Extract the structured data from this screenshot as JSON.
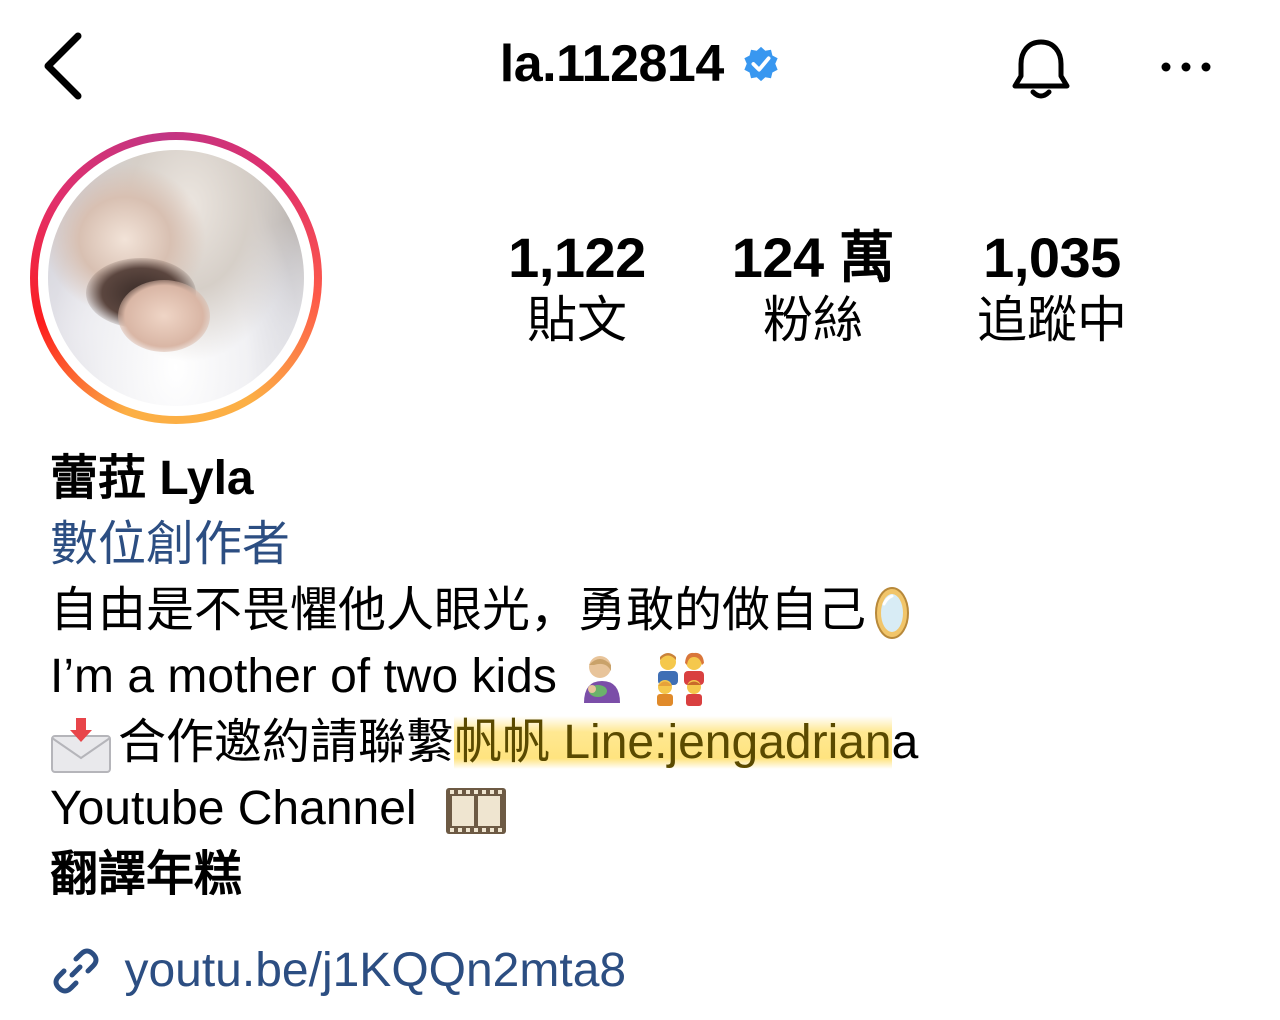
{
  "header": {
    "username": "la.112814",
    "back_icon": "chevron-left-icon",
    "verified_icon": "verified-badge-icon",
    "bell_icon": "bell-icon",
    "more_icon": "more-horizontal-icon",
    "verified_color": "#3897f0"
  },
  "stats": {
    "posts": {
      "value": "1,122",
      "label": "貼文"
    },
    "followers": {
      "value": "124 萬",
      "label": "粉絲"
    },
    "following": {
      "value": "1,035",
      "label": "追蹤中"
    }
  },
  "profile": {
    "display_name": "蕾菈 Lyla",
    "category": "數位創作者",
    "bio_line_1": "自由是不畏懼他人眼光，勇敢的做自己",
    "bio_line_2": "I’m a mother of two kids",
    "bio_line_3_prefix": "合作邀約請聯繫",
    "bio_line_3_highlight": "帆帆 Line:jengadrian",
    "bio_line_3_suffix": "a",
    "bio_line_4": "Youtube Channel",
    "bio_line_5": "翻譯年糕",
    "link": "youtu.be/j1KQQn2mta8",
    "link_icon": "link-icon",
    "category_color": "#2c4e82",
    "highlight_color": "#ffe48a"
  }
}
